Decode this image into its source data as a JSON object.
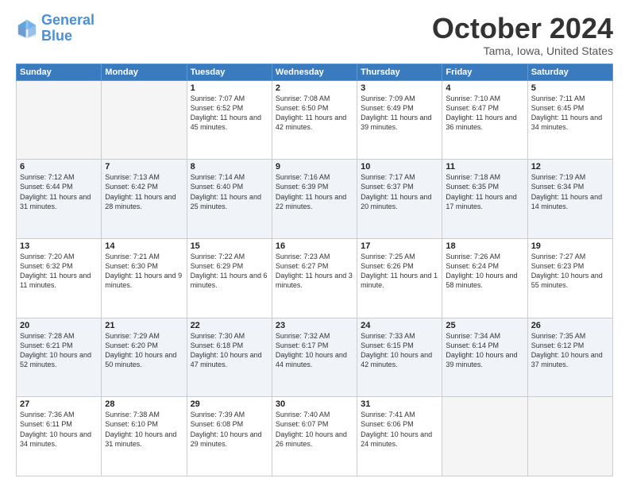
{
  "logo": {
    "line1": "General",
    "line2": "Blue"
  },
  "header": {
    "month": "October 2024",
    "location": "Tama, Iowa, United States"
  },
  "weekdays": [
    "Sunday",
    "Monday",
    "Tuesday",
    "Wednesday",
    "Thursday",
    "Friday",
    "Saturday"
  ],
  "weeks": [
    [
      {
        "day": "",
        "info": ""
      },
      {
        "day": "",
        "info": ""
      },
      {
        "day": "1",
        "info": "Sunrise: 7:07 AM\nSunset: 6:52 PM\nDaylight: 11 hours and 45 minutes."
      },
      {
        "day": "2",
        "info": "Sunrise: 7:08 AM\nSunset: 6:50 PM\nDaylight: 11 hours and 42 minutes."
      },
      {
        "day": "3",
        "info": "Sunrise: 7:09 AM\nSunset: 6:49 PM\nDaylight: 11 hours and 39 minutes."
      },
      {
        "day": "4",
        "info": "Sunrise: 7:10 AM\nSunset: 6:47 PM\nDaylight: 11 hours and 36 minutes."
      },
      {
        "day": "5",
        "info": "Sunrise: 7:11 AM\nSunset: 6:45 PM\nDaylight: 11 hours and 34 minutes."
      }
    ],
    [
      {
        "day": "6",
        "info": "Sunrise: 7:12 AM\nSunset: 6:44 PM\nDaylight: 11 hours and 31 minutes."
      },
      {
        "day": "7",
        "info": "Sunrise: 7:13 AM\nSunset: 6:42 PM\nDaylight: 11 hours and 28 minutes."
      },
      {
        "day": "8",
        "info": "Sunrise: 7:14 AM\nSunset: 6:40 PM\nDaylight: 11 hours and 25 minutes."
      },
      {
        "day": "9",
        "info": "Sunrise: 7:16 AM\nSunset: 6:39 PM\nDaylight: 11 hours and 22 minutes."
      },
      {
        "day": "10",
        "info": "Sunrise: 7:17 AM\nSunset: 6:37 PM\nDaylight: 11 hours and 20 minutes."
      },
      {
        "day": "11",
        "info": "Sunrise: 7:18 AM\nSunset: 6:35 PM\nDaylight: 11 hours and 17 minutes."
      },
      {
        "day": "12",
        "info": "Sunrise: 7:19 AM\nSunset: 6:34 PM\nDaylight: 11 hours and 14 minutes."
      }
    ],
    [
      {
        "day": "13",
        "info": "Sunrise: 7:20 AM\nSunset: 6:32 PM\nDaylight: 11 hours and 11 minutes."
      },
      {
        "day": "14",
        "info": "Sunrise: 7:21 AM\nSunset: 6:30 PM\nDaylight: 11 hours and 9 minutes."
      },
      {
        "day": "15",
        "info": "Sunrise: 7:22 AM\nSunset: 6:29 PM\nDaylight: 11 hours and 6 minutes."
      },
      {
        "day": "16",
        "info": "Sunrise: 7:23 AM\nSunset: 6:27 PM\nDaylight: 11 hours and 3 minutes."
      },
      {
        "day": "17",
        "info": "Sunrise: 7:25 AM\nSunset: 6:26 PM\nDaylight: 11 hours and 1 minute."
      },
      {
        "day": "18",
        "info": "Sunrise: 7:26 AM\nSunset: 6:24 PM\nDaylight: 10 hours and 58 minutes."
      },
      {
        "day": "19",
        "info": "Sunrise: 7:27 AM\nSunset: 6:23 PM\nDaylight: 10 hours and 55 minutes."
      }
    ],
    [
      {
        "day": "20",
        "info": "Sunrise: 7:28 AM\nSunset: 6:21 PM\nDaylight: 10 hours and 52 minutes."
      },
      {
        "day": "21",
        "info": "Sunrise: 7:29 AM\nSunset: 6:20 PM\nDaylight: 10 hours and 50 minutes."
      },
      {
        "day": "22",
        "info": "Sunrise: 7:30 AM\nSunset: 6:18 PM\nDaylight: 10 hours and 47 minutes."
      },
      {
        "day": "23",
        "info": "Sunrise: 7:32 AM\nSunset: 6:17 PM\nDaylight: 10 hours and 44 minutes."
      },
      {
        "day": "24",
        "info": "Sunrise: 7:33 AM\nSunset: 6:15 PM\nDaylight: 10 hours and 42 minutes."
      },
      {
        "day": "25",
        "info": "Sunrise: 7:34 AM\nSunset: 6:14 PM\nDaylight: 10 hours and 39 minutes."
      },
      {
        "day": "26",
        "info": "Sunrise: 7:35 AM\nSunset: 6:12 PM\nDaylight: 10 hours and 37 minutes."
      }
    ],
    [
      {
        "day": "27",
        "info": "Sunrise: 7:36 AM\nSunset: 6:11 PM\nDaylight: 10 hours and 34 minutes."
      },
      {
        "day": "28",
        "info": "Sunrise: 7:38 AM\nSunset: 6:10 PM\nDaylight: 10 hours and 31 minutes."
      },
      {
        "day": "29",
        "info": "Sunrise: 7:39 AM\nSunset: 6:08 PM\nDaylight: 10 hours and 29 minutes."
      },
      {
        "day": "30",
        "info": "Sunrise: 7:40 AM\nSunset: 6:07 PM\nDaylight: 10 hours and 26 minutes."
      },
      {
        "day": "31",
        "info": "Sunrise: 7:41 AM\nSunset: 6:06 PM\nDaylight: 10 hours and 24 minutes."
      },
      {
        "day": "",
        "info": ""
      },
      {
        "day": "",
        "info": ""
      }
    ]
  ]
}
